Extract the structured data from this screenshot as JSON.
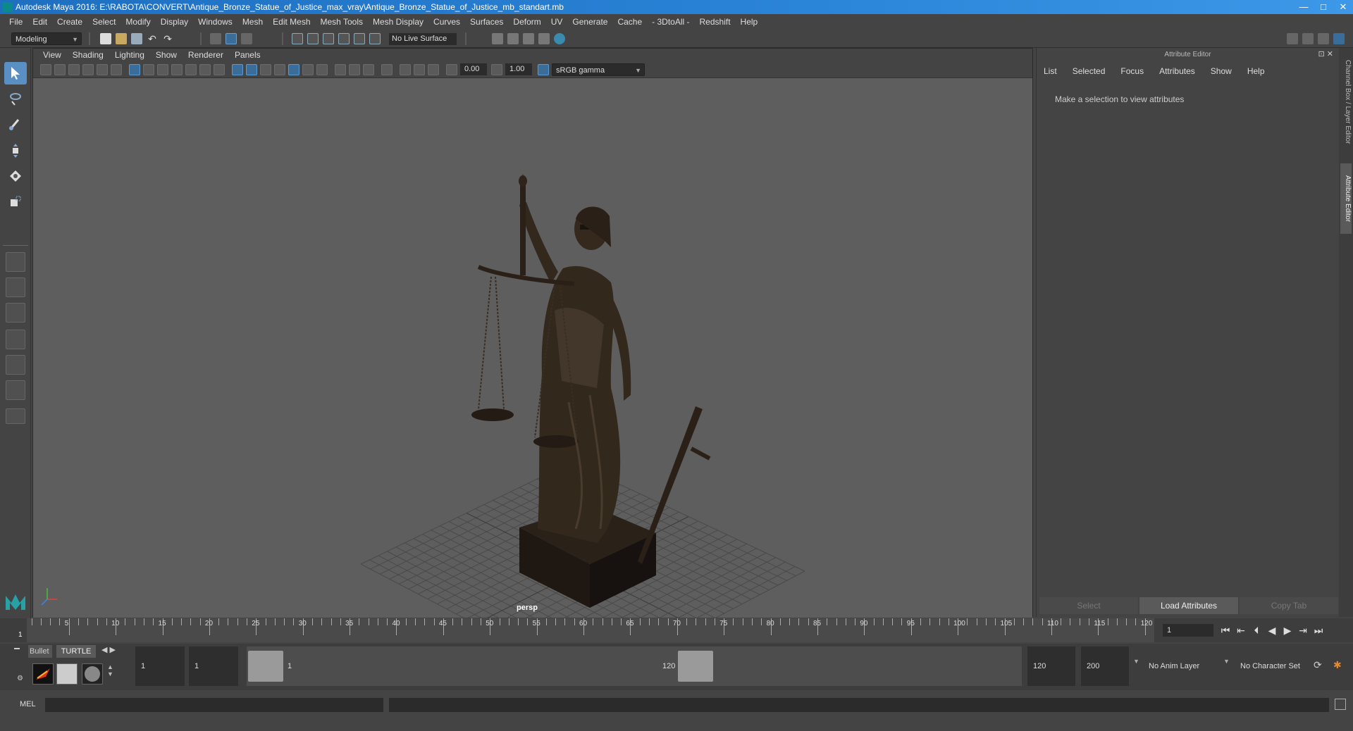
{
  "window": {
    "title": "Autodesk Maya 2016: E:\\RABOTA\\CONVERT\\Antique_Bronze_Statue_of_Justice_max_vray\\Antique_Bronze_Statue_of_Justice_mb_standart.mb",
    "controls": [
      "—",
      "□",
      "✕"
    ]
  },
  "menubar": [
    "File",
    "Edit",
    "Create",
    "Select",
    "Modify",
    "Display",
    "Windows",
    "Mesh",
    "Edit Mesh",
    "Mesh Tools",
    "Mesh Display",
    "Curves",
    "Surfaces",
    "Deform",
    "UV",
    "Generate",
    "Cache",
    "- 3DtoAll -",
    "Redshift",
    "Help"
  ],
  "shelf": {
    "mode": "Modeling",
    "live_surface": "No Live Surface"
  },
  "viewport": {
    "menu": [
      "View",
      "Shading",
      "Lighting",
      "Show",
      "Renderer",
      "Panels"
    ],
    "exposure": "0.00",
    "gamma": "1.00",
    "color_space": "sRGB gamma",
    "camera_label": "persp"
  },
  "attribute_editor": {
    "title": "Attribute Editor",
    "menu": [
      "List",
      "Selected",
      "Focus",
      "Attributes",
      "Show",
      "Help"
    ],
    "message": "Make a selection to view attributes",
    "buttons": [
      "Select",
      "Load Attributes",
      "Copy Tab"
    ]
  },
  "side_tabs": [
    "Channel Box / Layer Editor",
    "Attribute Editor"
  ],
  "timeline": {
    "start_marker": "1",
    "ticks": [
      "5",
      "10",
      "15",
      "20",
      "25",
      "30",
      "35",
      "40",
      "45",
      "50",
      "55",
      "60",
      "65",
      "70",
      "75",
      "80",
      "85",
      "90",
      "95",
      "100",
      "105",
      "110",
      "115",
      "120"
    ],
    "current_frame": "1"
  },
  "shelf_tabs": [
    "Bullet",
    "TURTLE"
  ],
  "range": {
    "start": "1",
    "playback_start": "1",
    "slider_start_label": "1",
    "slider_end_label": "120",
    "playback_end": "120",
    "end": "200",
    "anim_layer": "No Anim Layer",
    "character_set": "No Character Set"
  },
  "command_line": {
    "label": "MEL"
  },
  "colors": {
    "titlebar": "#2a84d8",
    "panel": "#444444",
    "viewport_bg": "#5e5e5e",
    "statue": "#2e241a",
    "accent": "#5a8fc4"
  }
}
